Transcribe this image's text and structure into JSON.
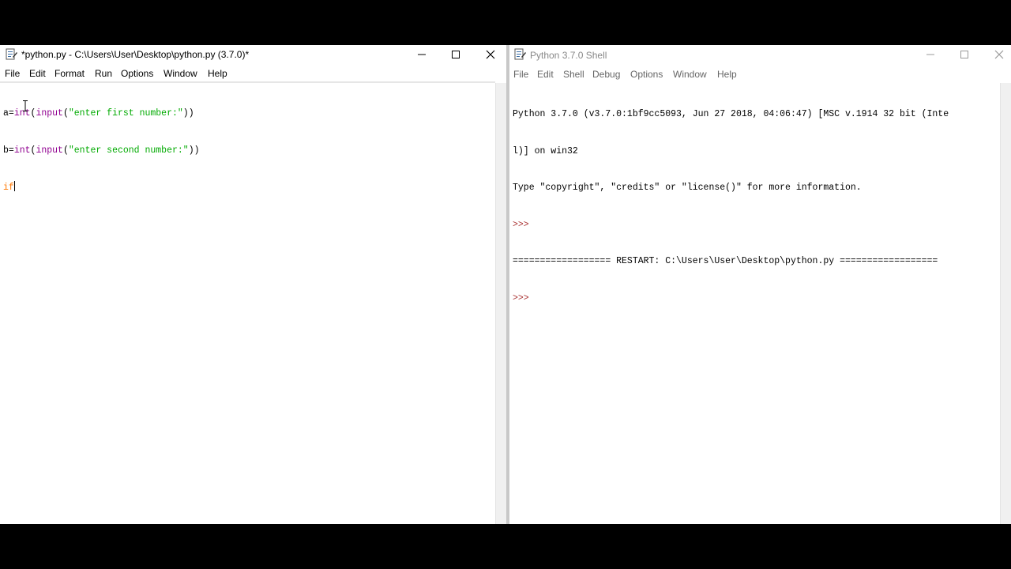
{
  "editor": {
    "title": "*python.py - C:\\Users\\User\\Desktop\\python.py (3.7.0)*",
    "menu": [
      "File",
      "Edit",
      "Format",
      "Run",
      "Options",
      "Window",
      "Help"
    ],
    "code": {
      "line1": {
        "p1": "a=",
        "p2": "int",
        "p3": "(",
        "p4": "input",
        "p5": "(",
        "p6": "\"enter first number:\"",
        "p7": "))"
      },
      "line2": {
        "p1": "b=",
        "p2": "int",
        "p3": "(",
        "p4": "input",
        "p5": "(",
        "p6": "\"enter second number:\"",
        "p7": "))"
      },
      "line3": {
        "p1": "if"
      }
    }
  },
  "shell": {
    "title": "Python 3.7.0 Shell",
    "menu": [
      "File",
      "Edit",
      "Shell",
      "Debug",
      "Options",
      "Window",
      "Help"
    ],
    "lines": [
      "Python 3.7.0 (v3.7.0:1bf9cc5093, Jun 27 2018, 04:06:47) [MSC v.1914 32 bit (Inte",
      "l)] on win32",
      "Type \"copyright\", \"credits\" or \"license()\" for more information.",
      ">>>",
      "================== RESTART: C:\\Users\\User\\Desktop\\python.py ==================",
      ">>>"
    ]
  },
  "colors": {
    "builtin": "#900090",
    "string": "#00aa00",
    "keyword": "#ff7700",
    "prompt": "#aa3333"
  }
}
